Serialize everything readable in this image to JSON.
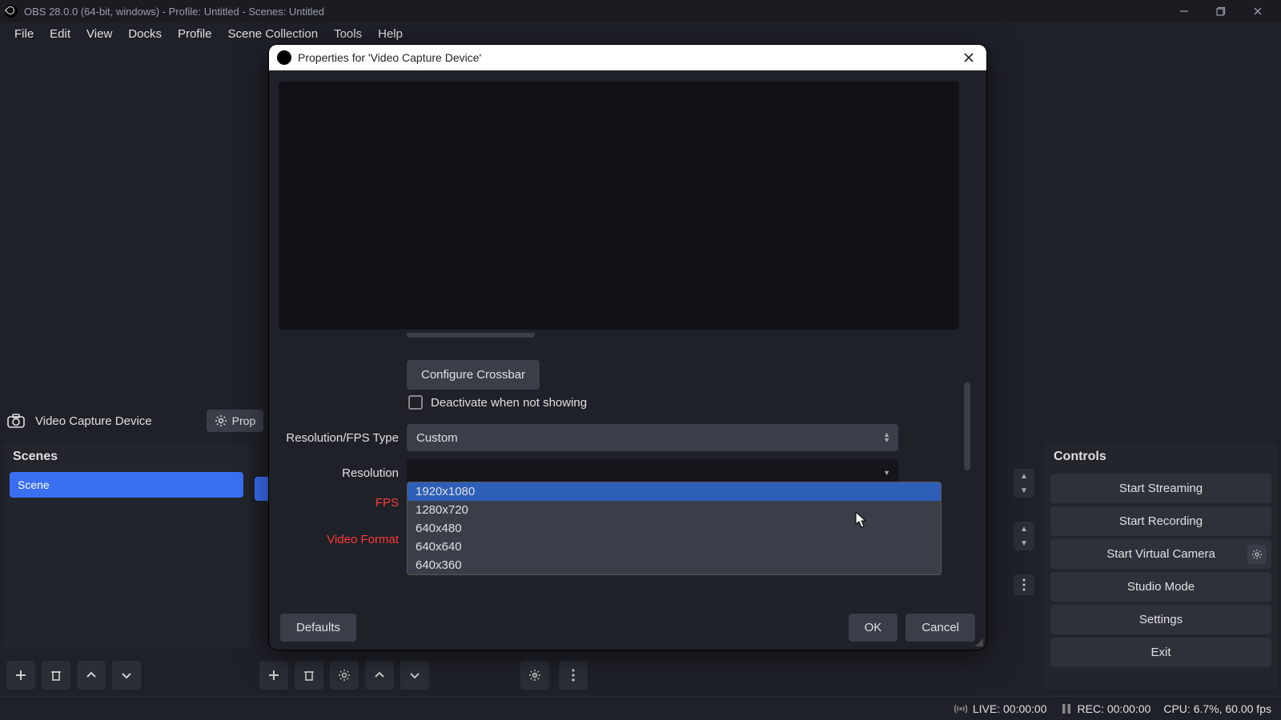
{
  "titlebar": {
    "text": "OBS 28.0.0 (64-bit, windows) - Profile: Untitled - Scenes: Untitled"
  },
  "menubar": [
    "File",
    "Edit",
    "View",
    "Docks",
    "Profile",
    "Scene Collection",
    "Tools",
    "Help"
  ],
  "source_toolbar": {
    "source_label": "Video Capture Device",
    "properties_label": "Prop"
  },
  "scenes": {
    "title": "Scenes",
    "items": [
      "Scene"
    ]
  },
  "controls": {
    "title": "Controls",
    "start_streaming": "Start Streaming",
    "start_recording": "Start Recording",
    "start_virtual_camera": "Start Virtual Camera",
    "studio_mode": "Studio Mode",
    "settings": "Settings",
    "exit": "Exit"
  },
  "statusbar": {
    "live": "LIVE: 00:00:00",
    "rec": "REC: 00:00:00",
    "cpu": "CPU: 6.7%, 60.00 fps"
  },
  "dialog": {
    "title": "Properties for 'Video Capture Device'",
    "configure_crossbar": "Configure Crossbar",
    "deactivate_label": "Deactivate when not showing",
    "res_fps_type_label": "Resolution/FPS Type",
    "res_fps_type_value": "Custom",
    "resolution_label": "Resolution",
    "resolution_value": "",
    "fps_label": "FPS",
    "video_format_label": "Video Format",
    "dropdown_options": [
      "1920x1080",
      "1280x720",
      "640x480",
      "640x640",
      "640x360"
    ],
    "defaults": "Defaults",
    "ok": "OK",
    "cancel": "Cancel"
  }
}
